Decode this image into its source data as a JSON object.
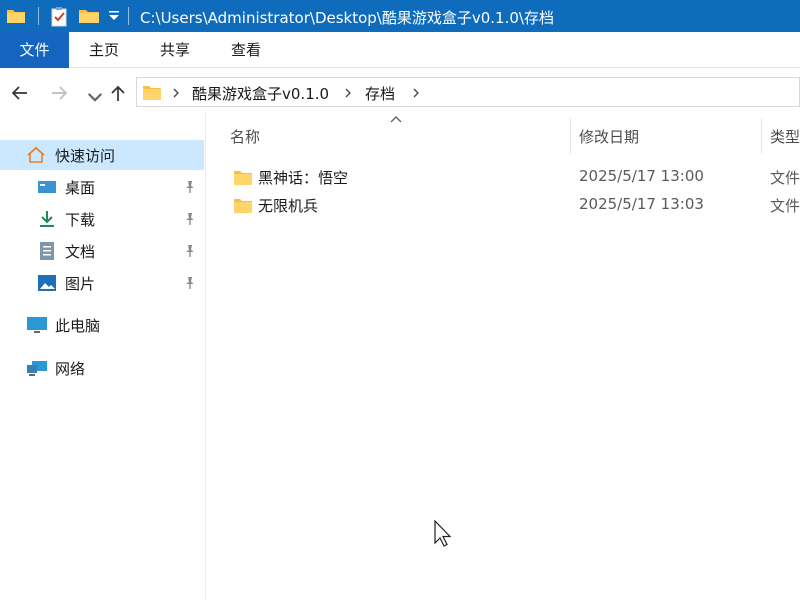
{
  "window": {
    "title": "C:\\Users\\Administrator\\Desktop\\酷果游戏盒子v0.1.0\\存档"
  },
  "ribbon": {
    "tabs": [
      {
        "label": "文件"
      },
      {
        "label": "主页"
      },
      {
        "label": "共享"
      },
      {
        "label": "查看"
      }
    ]
  },
  "address": {
    "crumbs": [
      "酷果游戏盒子v0.1.0",
      "存档"
    ]
  },
  "nav": {
    "quick_access": "快速访问",
    "pinned": [
      {
        "label": "桌面",
        "icon": "desktop-icon"
      },
      {
        "label": "下载",
        "icon": "download-icon"
      },
      {
        "label": "文档",
        "icon": "document-icon"
      },
      {
        "label": "图片",
        "icon": "pictures-icon"
      }
    ],
    "this_pc": "此电脑",
    "network": "网络"
  },
  "columns": {
    "name": "名称",
    "date": "修改日期",
    "type": "类型"
  },
  "files": [
    {
      "name": "黑神话：悟空",
      "date": "2025/5/17 13:00",
      "type": "文件"
    },
    {
      "name": "无限机兵",
      "date": "2025/5/17 13:03",
      "type": "文件"
    }
  ],
  "colors": {
    "titlebar": "#0f6cbd",
    "file_tab": "#1565c0",
    "selection": "#cce8ff",
    "folder": "#f8c146"
  }
}
